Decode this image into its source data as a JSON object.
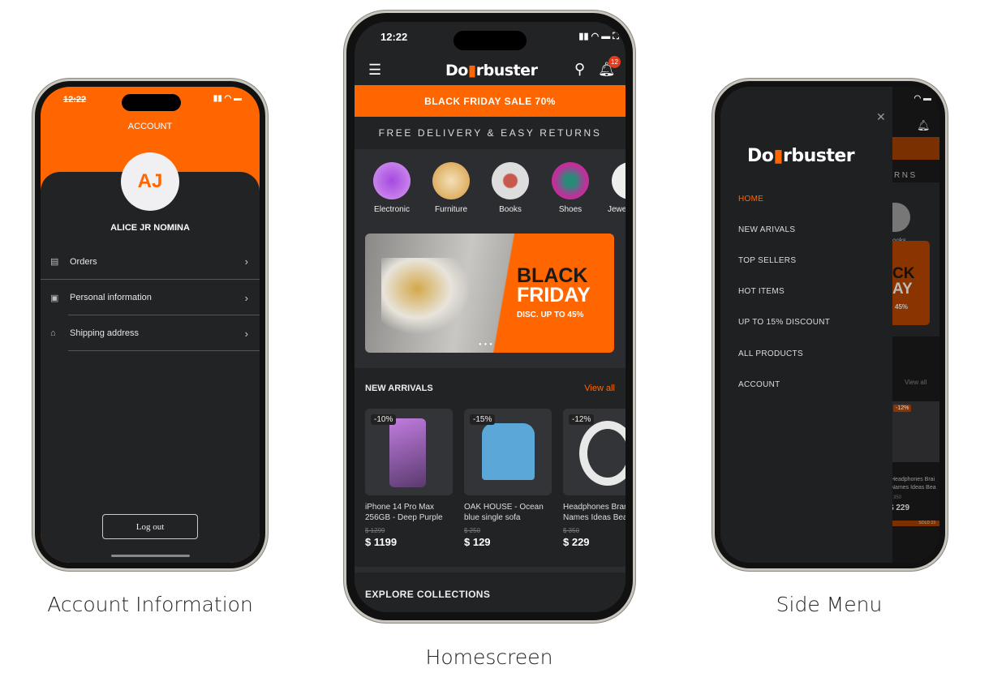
{
  "captions": {
    "account": "Account Information",
    "home": "Homescreen",
    "side": "Side Menu"
  },
  "status": {
    "time": "12:22",
    "notif_count": "12"
  },
  "brand": {
    "logo": "Doorbuster",
    "accent": "#ff6600"
  },
  "account": {
    "title": "ACCOUNT",
    "initials": "AJ",
    "name": "ALICE JR NOMINA",
    "items": [
      {
        "label": "Orders",
        "icon": "receipt-icon"
      },
      {
        "label": "Personal information",
        "icon": "id-card-icon"
      },
      {
        "label": "Shipping address",
        "icon": "map-icon"
      }
    ],
    "logout": "Log out"
  },
  "home": {
    "promo": "BLACK FRIDAY SALE 70%",
    "delivery": "FREE DELIVERY & EASY RETURNS",
    "categories": [
      "Electronic",
      "Furniture",
      "Books",
      "Shoes",
      "Jewelry"
    ],
    "banner": {
      "line1": "BLACK",
      "line2": "FRIDAY",
      "sub": "DISC. UP TO 45%"
    },
    "new_arrivals": {
      "title": "NEW ARRIVALS",
      "view_all": "View all",
      "products": [
        {
          "discount": "-10%",
          "name1": "iPhone 14 Pro Max",
          "name2": "256GB - Deep Purple",
          "old": "$ 1299",
          "price": "$ 1199"
        },
        {
          "discount": "-15%",
          "name1": "OAK HOUSE - Ocean",
          "name2": "blue single sofa",
          "old": "$ 250",
          "price": "$ 129"
        },
        {
          "discount": "-12%",
          "name1": "Headphones Brand",
          "name2": "Names Ideas Beats",
          "old": "$ 350",
          "price": "$ 229"
        }
      ]
    },
    "explore": "EXPLORE COLLECTIONS"
  },
  "side_menu": {
    "items": [
      "HOME",
      "NEW ARIVALS",
      "TOP SELLERS",
      "HOT ITEMS",
      "UP TO 15% DISCOUNT",
      "ALL PRODUCTS",
      "ACCOUNT"
    ],
    "bg_fragments": {
      "rns": "RNS",
      "books": "ooks",
      "banner1": "CK",
      "banner2": "AY",
      "banner3": "45%",
      "view_all": "View all",
      "badge": "-12%",
      "name1": "Headphones Brai",
      "name2": "Names Ideas Bea",
      "old": "$ 350",
      "price": "$ 229",
      "sold": "SOLD 23"
    }
  }
}
